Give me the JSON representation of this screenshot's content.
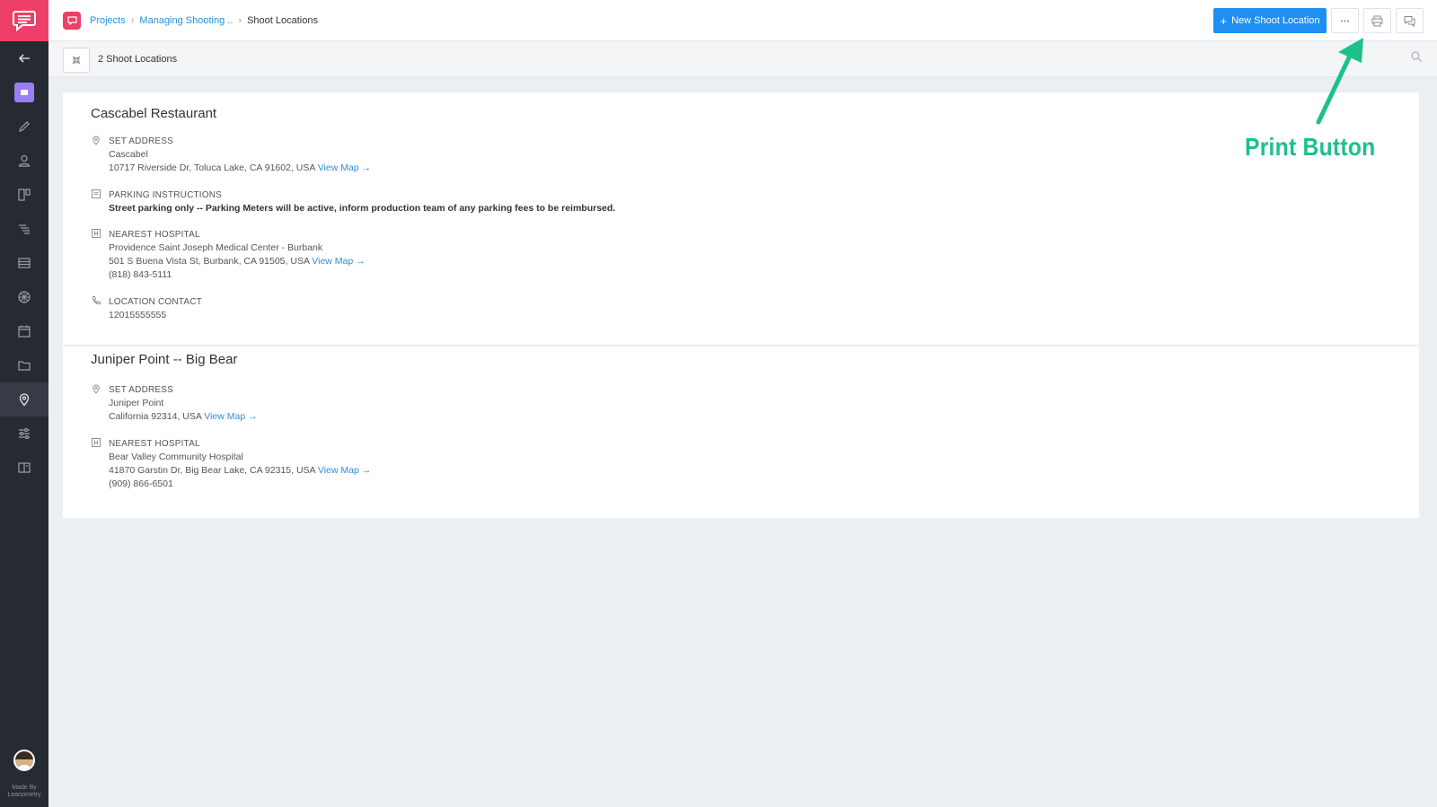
{
  "breadcrumb": {
    "root": "Projects",
    "project": "Managing Shooting ..",
    "current": "Shoot Locations"
  },
  "header": {
    "new_button": "New Shoot Location",
    "new_button_icon": "+"
  },
  "subbar": {
    "count": "2 Shoot Locations"
  },
  "sidebar": {
    "made_by_line1": "Made By",
    "made_by_line2": "Leanometry",
    "items": [
      "back-arrow",
      "overview",
      "script",
      "characters",
      "storyboard",
      "shot-list",
      "stripboard",
      "elements",
      "calendar",
      "files",
      "locations",
      "settings",
      "reports"
    ],
    "active": "locations"
  },
  "locations": [
    {
      "title": "Cascabel Restaurant",
      "set_address": {
        "label": "SET ADDRESS",
        "name": "Cascabel",
        "address": "10717 Riverside Dr, Toluca Lake, CA 91602, USA",
        "map_link": "View Map →"
      },
      "parking": {
        "label": "PARKING INSTRUCTIONS",
        "text": "Street parking only -- Parking Meters will be active, inform production team of any parking fees to be reimbursed."
      },
      "hospital": {
        "label": "NEAREST HOSPITAL",
        "name": "Providence Saint Joseph Medical Center - Burbank",
        "address": "501 S Buena Vista St, Burbank, CA 91505, USA",
        "map_link": "View Map →",
        "phone": "(818) 843-5111"
      },
      "contact": {
        "label": "LOCATION CONTACT",
        "value": "12015555555"
      }
    },
    {
      "title": "Juniper Point -- Big Bear",
      "set_address": {
        "label": "SET ADDRESS",
        "name": "Juniper Point",
        "address": "California 92314, USA",
        "map_link": "View Map →"
      },
      "hospital": {
        "label": "NEAREST HOSPITAL",
        "name": "Bear Valley Community Hospital",
        "address": "41870 Garstin Dr, Big Bear Lake, CA 92315, USA",
        "map_link": "View Map →",
        "phone": "(909) 866-6501"
      }
    }
  ],
  "annotation": {
    "text": "Print Button",
    "color": "#1cc08b"
  },
  "colors": {
    "brand": "#ee3f68",
    "primary_button": "#1f8ff2",
    "link": "#2a8fd6",
    "sidebar_bg": "#262a33"
  }
}
